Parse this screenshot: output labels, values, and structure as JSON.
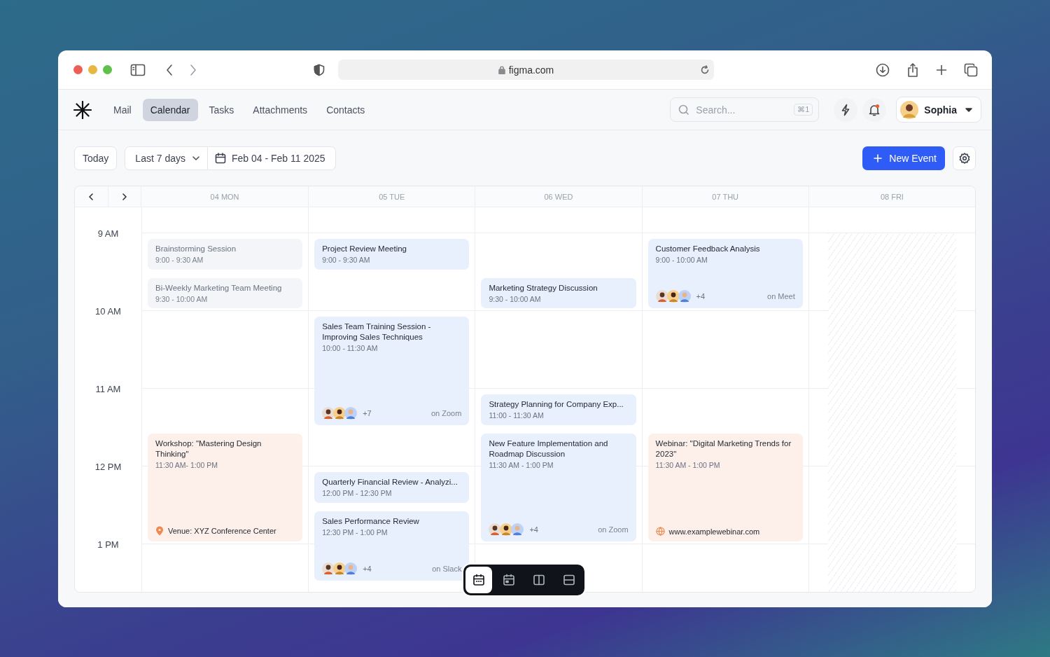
{
  "browser": {
    "url": "figma.com"
  },
  "nav": [
    {
      "label": "Mail",
      "selected": false
    },
    {
      "label": "Calendar",
      "selected": true
    },
    {
      "label": "Tasks",
      "selected": false
    },
    {
      "label": "Attachments",
      "selected": false
    },
    {
      "label": "Contacts",
      "selected": false
    }
  ],
  "search": {
    "placeholder": "Search...",
    "shortcut": "⌘1"
  },
  "notifications": {
    "unread": true
  },
  "user": {
    "name": "Sophia"
  },
  "toolbar": {
    "today": "Today",
    "range_preset": "Last 7 days",
    "date_range": "Feb 04 - Feb 11 2025",
    "new_event": "New Event"
  },
  "calendar": {
    "hours": [
      "9 AM",
      "10 AM",
      "11 AM",
      "12 PM",
      "1 PM"
    ],
    "days": [
      {
        "label": "04 MON",
        "unavailable": false,
        "events": [
          {
            "title": "Brainstorming Session",
            "time": "9:00 - 9:30 AM",
            "color": "#f3f5f9",
            "muted": true
          },
          {
            "title": "Bi-Weekly Marketing Team Meeting",
            "time": "9:30 - 10:00 AM",
            "color": "#f3f5f9",
            "muted": true
          },
          {
            "title": "Workshop: \"Mastering Design Thinking\"",
            "time": "11:30 AM- 1:00 PM",
            "color": "#fdf0ea",
            "muted": false,
            "footer": {
              "kind": "venue",
              "text": "Venue: XYZ Conference Center"
            }
          }
        ]
      },
      {
        "label": "05 TUE",
        "unavailable": false,
        "events": [
          {
            "title": "Project Review Meeting",
            "time": "9:00 - 9:30 AM",
            "color": "#e8effd",
            "muted": false
          },
          {
            "title": "Sales Team Training Session - Improving Sales Techniques",
            "time": "10:00 - 11:30 AM",
            "color": "#e8effd",
            "muted": false,
            "footer": {
              "kind": "attendees",
              "extra": "+7",
              "platform": "on Zoom"
            }
          },
          {
            "title": "Quarterly Financial Review - Analyzi...",
            "time": "12:00 PM - 12:30 PM",
            "color": "#e8effd",
            "muted": false
          },
          {
            "title": "Sales Performance Review",
            "time": "12:30 PM - 1:00 PM",
            "color": "#e8effd",
            "muted": false,
            "footer": {
              "kind": "attendees",
              "extra": "+4",
              "platform": "on Slack"
            }
          }
        ]
      },
      {
        "label": "06 WED",
        "unavailable": false,
        "events": [
          {
            "title": "Marketing Strategy Discussion",
            "time": "9:30 - 10:00 AM",
            "color": "#e8effd",
            "muted": false
          },
          {
            "title": "Strategy Planning for Company Exp...",
            "time": "11:00 - 11:30 AM",
            "color": "#e8effd",
            "muted": false
          },
          {
            "title": "New Feature Implementation and Roadmap Discussion",
            "time": "11:30 AM - 1:00 PM",
            "color": "#e8effd",
            "muted": false,
            "footer": {
              "kind": "attendees",
              "extra": "+4",
              "platform": "on Zoom"
            }
          }
        ]
      },
      {
        "label": "07 THU",
        "unavailable": false,
        "events": [
          {
            "title": "Customer Feedback Analysis",
            "time": "9:00 - 10:00 AM",
            "color": "#e8effd",
            "muted": false,
            "footer": {
              "kind": "attendees",
              "extra": "+4",
              "platform": "on Meet"
            }
          },
          {
            "title": "Webinar: \"Digital Marketing Trends for 2023\"",
            "time": "11:30 AM - 1:00 PM",
            "color": "#fdf0ea",
            "muted": false,
            "footer": {
              "kind": "link",
              "text": "www.examplewebinar.com"
            }
          }
        ]
      },
      {
        "label": "08 FRI",
        "unavailable": true
      }
    ]
  },
  "view_switcher": [
    {
      "kind": "month",
      "selected": true
    },
    {
      "kind": "day",
      "selected": false
    },
    {
      "kind": "columns",
      "selected": false
    },
    {
      "kind": "rows",
      "selected": false
    }
  ]
}
